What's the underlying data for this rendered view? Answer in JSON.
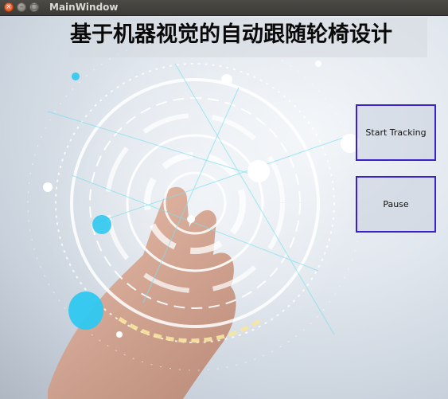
{
  "window": {
    "title": "MainWindow",
    "controls": {
      "close": "×",
      "minimize": "–",
      "maximize": "□"
    }
  },
  "heading": "基于机器视觉的自动跟随轮椅设计",
  "buttons": {
    "start": "Start Tracking",
    "pause": "Pause"
  },
  "colors": {
    "titlebar": "#3f3e3a",
    "button_border": "#3a22c8",
    "accent_cyan": "#2fc8f0"
  }
}
